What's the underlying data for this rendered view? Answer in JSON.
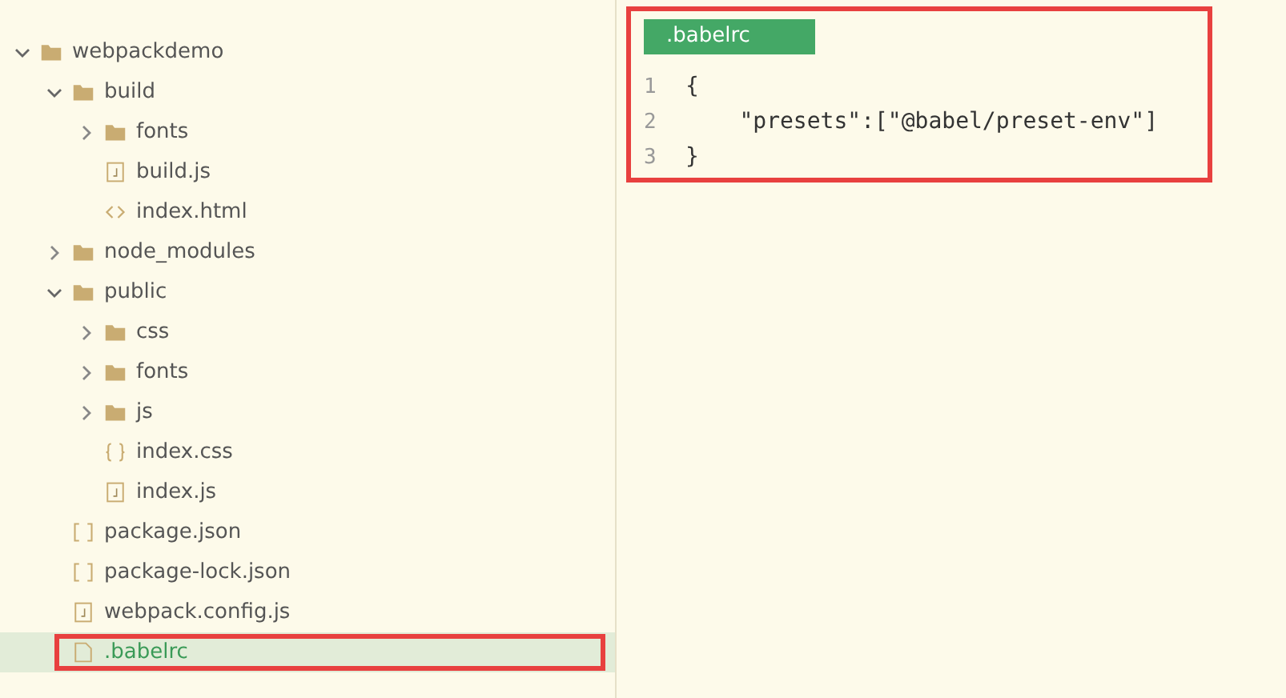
{
  "tree": [
    {
      "label": "webpackdemo",
      "kind": "folder",
      "expanded": true,
      "selected": false,
      "highlighted": false,
      "children": [
        {
          "label": "build",
          "kind": "folder",
          "expanded": true,
          "selected": false,
          "highlighted": false,
          "children": [
            {
              "label": "fonts",
              "kind": "folder",
              "expanded": false,
              "selected": false,
              "highlighted": false
            },
            {
              "label": "build.js",
              "kind": "js",
              "selected": false,
              "highlighted": false
            },
            {
              "label": "index.html",
              "kind": "html",
              "selected": false,
              "highlighted": false
            }
          ]
        },
        {
          "label": "node_modules",
          "kind": "folder",
          "expanded": false,
          "selected": false,
          "highlighted": false
        },
        {
          "label": "public",
          "kind": "folder",
          "expanded": true,
          "selected": false,
          "highlighted": false,
          "children": [
            {
              "label": "css",
              "kind": "folder",
              "expanded": false,
              "selected": false,
              "highlighted": false
            },
            {
              "label": "fonts",
              "kind": "folder",
              "expanded": false,
              "selected": false,
              "highlighted": false
            },
            {
              "label": "js",
              "kind": "folder",
              "expanded": false,
              "selected": false,
              "highlighted": false
            },
            {
              "label": "index.css",
              "kind": "css",
              "selected": false,
              "highlighted": false
            },
            {
              "label": "index.js",
              "kind": "js",
              "selected": false,
              "highlighted": false
            }
          ]
        },
        {
          "label": "package.json",
          "kind": "json",
          "selected": false,
          "highlighted": false
        },
        {
          "label": "package-lock.json",
          "kind": "json",
          "selected": false,
          "highlighted": false
        },
        {
          "label": "webpack.config.js",
          "kind": "js",
          "selected": false,
          "highlighted": false
        },
        {
          "label": ".babelrc",
          "kind": "file",
          "selected": true,
          "highlighted": true
        }
      ]
    }
  ],
  "editor": {
    "tab": ".babelrc",
    "highlighted": true,
    "lines": [
      {
        "number": "1",
        "text": "{"
      },
      {
        "number": "2",
        "text": "    \"presets\":[\"@babel/preset-env\"]"
      },
      {
        "number": "3",
        "text": "}"
      }
    ]
  }
}
